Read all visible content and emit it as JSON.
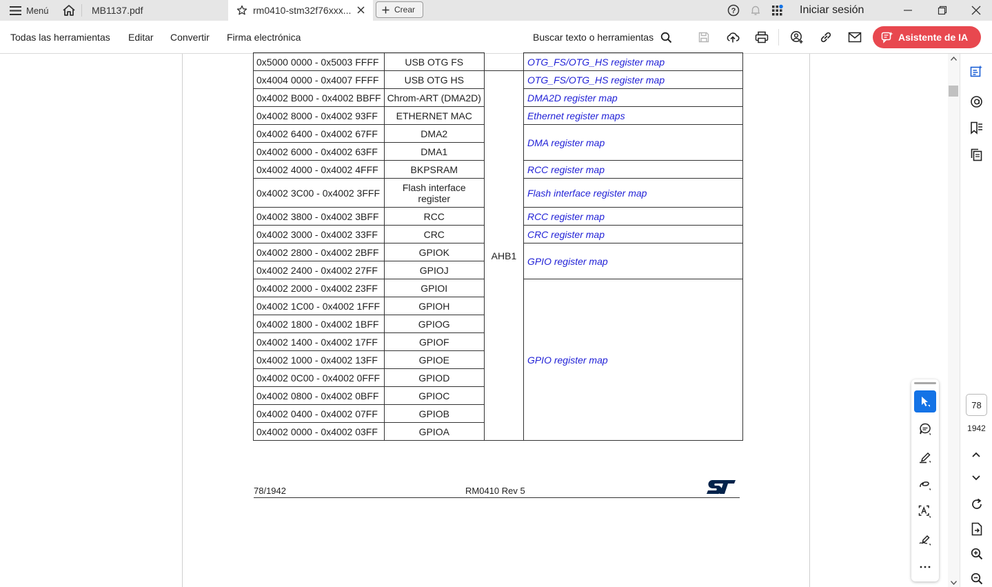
{
  "tabbar": {
    "menu_label": "Menú",
    "tabs": [
      {
        "label": "MB1137.pdf",
        "active": false
      },
      {
        "label": "rm0410-stm32f76xxx...",
        "active": true
      }
    ],
    "create_label": "Crear",
    "signin_label": "Iniciar sesión"
  },
  "toolbar": {
    "menus": [
      "Todas las herramientas",
      "Editar",
      "Convertir",
      "Firma electrónica"
    ],
    "search_label": "Buscar texto o herramientas",
    "ai_button_label": "Asistente de IA",
    "ai_color": "#e8484f"
  },
  "table": {
    "rows": [
      {
        "addr": "0x5000 0000 - 0x5003 FFFF",
        "periph": "USB OTG FS",
        "map": "OTG_FS/OTG_HS register map"
      },
      {
        "addr": "0x4004 0000 - 0x4007 FFFF",
        "periph": "USB OTG HS",
        "map": "OTG_FS/OTG_HS register map"
      },
      {
        "addr": "0x4002 B000 - 0x4002 BBFF",
        "periph": "Chrom-ART (DMA2D)",
        "map": "DMA2D register map"
      },
      {
        "addr": "0x4002 8000 - 0x4002 93FF",
        "periph": "ETHERNET MAC",
        "map": "Ethernet register maps"
      },
      {
        "addr": "0x4002 6400 - 0x4002 67FF",
        "periph": "DMA2",
        "map": "DMA register map"
      },
      {
        "addr": "0x4002 6000 - 0x4002 63FF",
        "periph": "DMA1"
      },
      {
        "addr": "0x4002 4000 - 0x4002 4FFF",
        "periph": "BKPSRAM",
        "map": "RCC register map"
      },
      {
        "addr": "0x4002 3C00 - 0x4002 3FFF",
        "periph": "Flash interface register",
        "map": "Flash interface register map"
      },
      {
        "addr": "0x4002 3800 - 0x4002 3BFF",
        "periph": "RCC",
        "map": "RCC register map"
      },
      {
        "addr": "0x4002 3000 - 0x4002 33FF",
        "periph": "CRC",
        "map": "CRC register map"
      },
      {
        "addr": "0x4002 2800 - 0x4002 2BFF",
        "periph": "GPIOK",
        "map": "GPIO register map"
      },
      {
        "addr": "0x4002 2400 - 0x4002 27FF",
        "periph": "GPIOJ"
      },
      {
        "addr": "0x4002 2000 - 0x4002 23FF",
        "periph": "GPIOI",
        "map": "GPIO register map"
      },
      {
        "addr": "0x4002 1C00 - 0x4002 1FFF",
        "periph": "GPIOH"
      },
      {
        "addr": "0x4002 1800 - 0x4002 1BFF",
        "periph": "GPIOG"
      },
      {
        "addr": "0x4002 1400 - 0x4002 17FF",
        "periph": "GPIOF"
      },
      {
        "addr": "0x4002 1000 - 0x4002 13FF",
        "periph": "GPIOE"
      },
      {
        "addr": "0x4002 0C00 - 0x4002 0FFF",
        "periph": "GPIOD"
      },
      {
        "addr": "0x4002 0800 - 0x4002 0BFF",
        "periph": "GPIOC"
      },
      {
        "addr": "0x4002 0400 - 0x4002 07FF",
        "periph": "GPIOB"
      },
      {
        "addr": "0x4002 0000 - 0x4002 03FF",
        "periph": "GPIOA"
      }
    ],
    "bus_label": "AHB1"
  },
  "footer": {
    "page_label": "78/1942",
    "doc_rev": "RM0410 Rev 5",
    "logo_text": "ST"
  },
  "pager": {
    "current_page": "78",
    "total_pages": "1942"
  }
}
